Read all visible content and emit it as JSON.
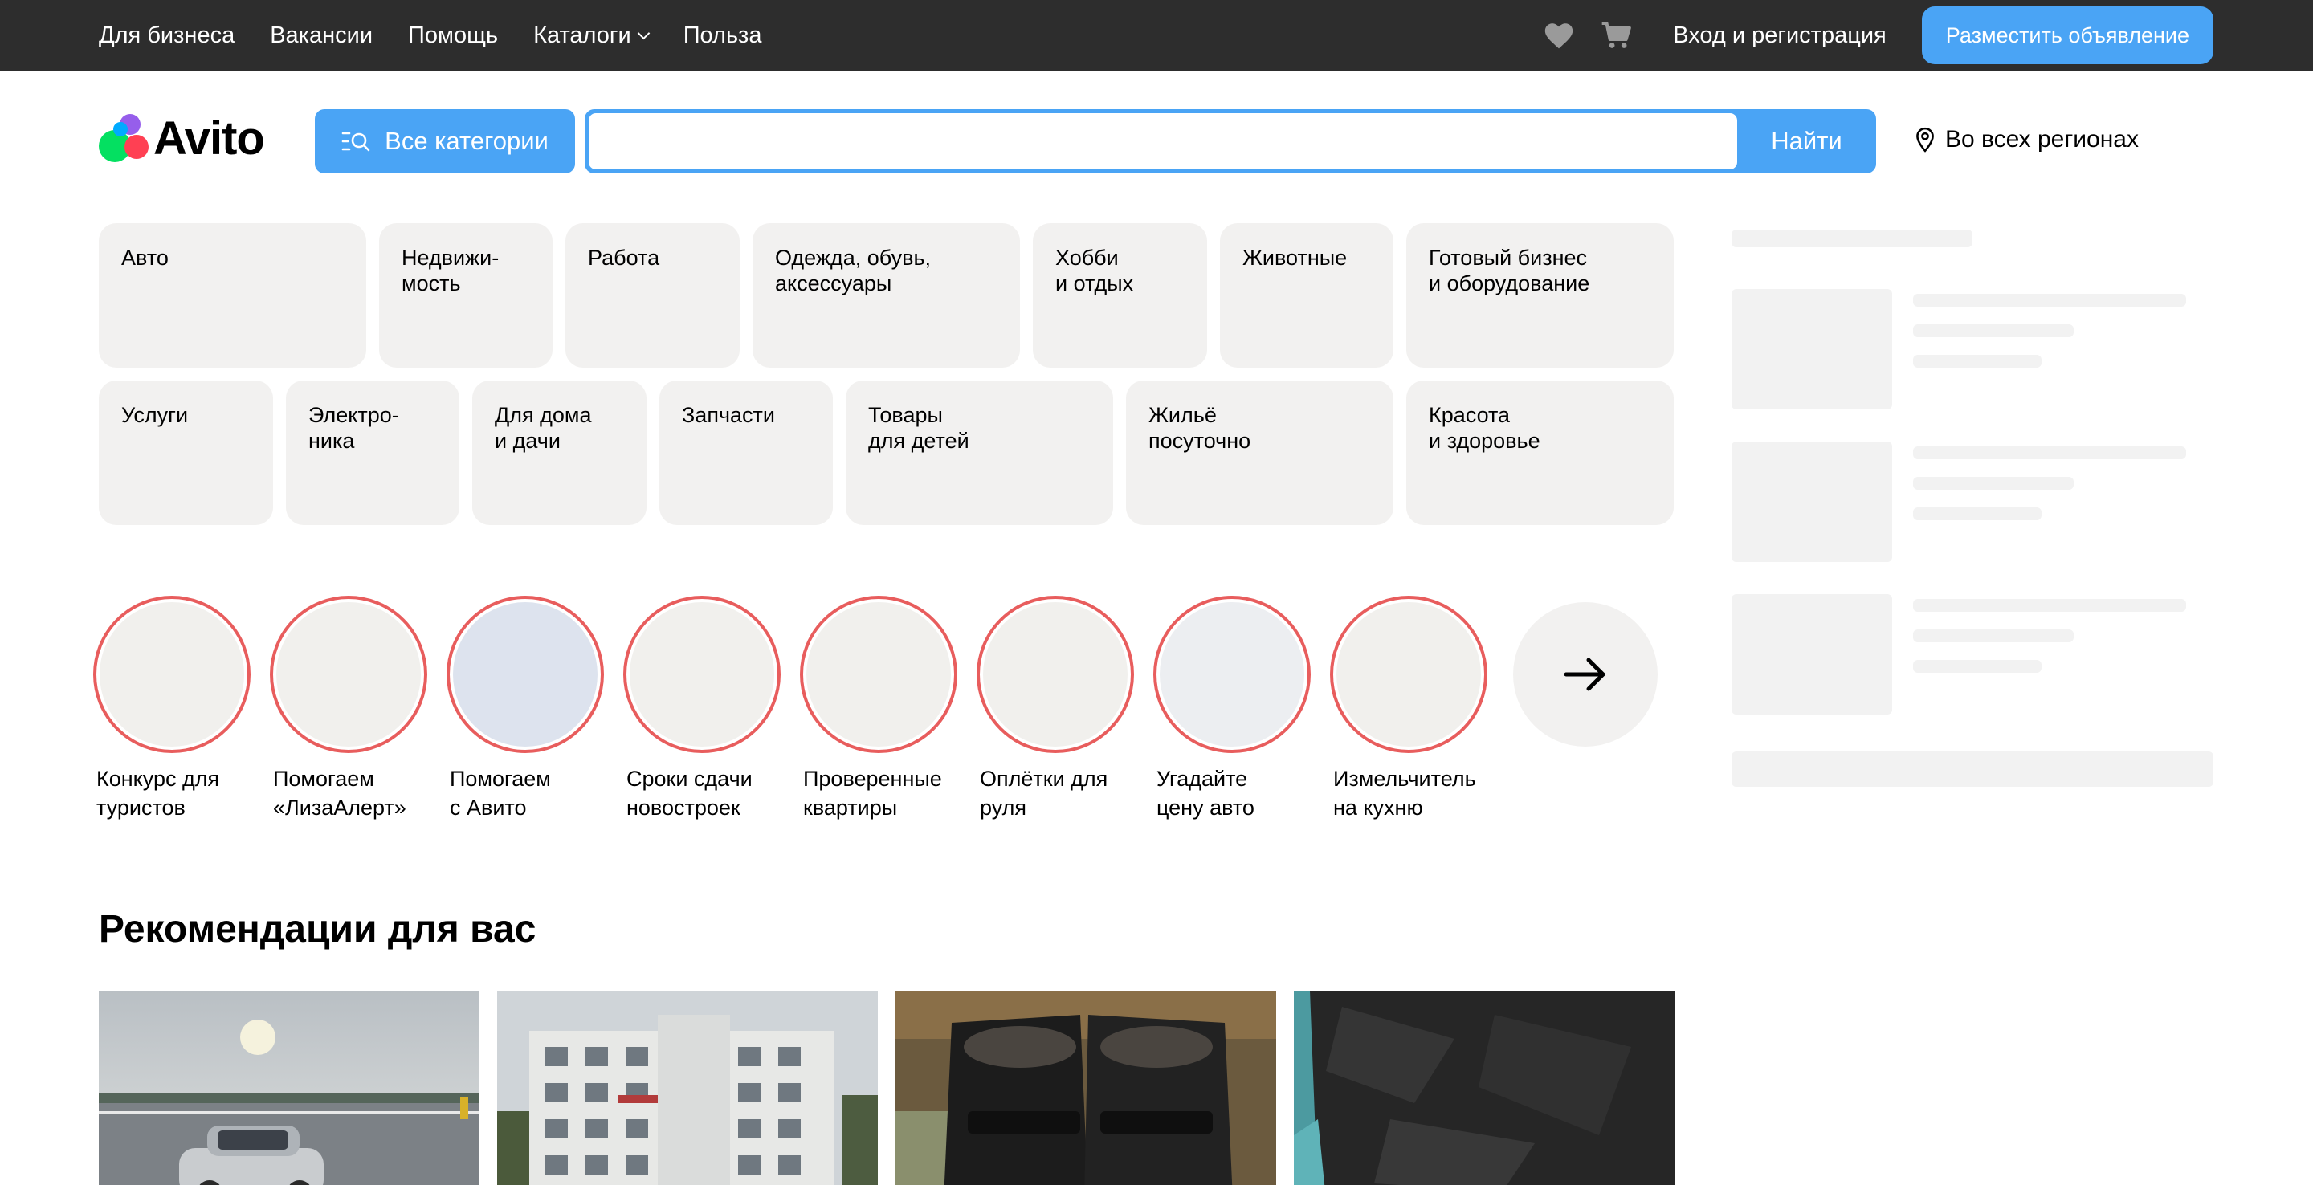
{
  "topbar": {
    "nav": [
      {
        "label": "Для бизнеса"
      },
      {
        "label": "Вакансии"
      },
      {
        "label": "Помощь"
      },
      {
        "label": "Каталоги"
      },
      {
        "label": "Польза"
      }
    ],
    "login_label": "Вход и регистрация",
    "post_ad_label": "Разместить объявление"
  },
  "header": {
    "logo_text": "Avito",
    "categories_button": "Все категории",
    "search": {
      "value": "",
      "placeholder": ""
    },
    "search_button": "Найти",
    "region": "Во всех регионах"
  },
  "categories": {
    "row1": [
      "Авто",
      "Недвижи-\nмость",
      "Работа",
      "Одежда, обувь,\nаксессуары",
      "Хобби\nи отдых",
      "Животные",
      "Готовый бизнес\nи оборудование"
    ],
    "row2": [
      "Услуги",
      "Электро-\nника",
      "Для дома\nи дачи",
      "Запчасти",
      "Товары\nдля детей",
      "Жильё\nпосуточно",
      "Красота\nи здоровье"
    ]
  },
  "stories": [
    {
      "label": "Конкурс для\nтуристов",
      "color": "#f1f0ed"
    },
    {
      "label": "Помогаем\n«ЛизаАлерт»",
      "color": "#f1f0ed"
    },
    {
      "label": "Помогаем\nс Авито",
      "color": "#dde3ee"
    },
    {
      "label": "Сроки сдачи\nновостроек",
      "color": "#f1f0ed"
    },
    {
      "label": "Проверенные\nквартиры",
      "color": "#f1f0ed"
    },
    {
      "label": "Оплётки для\nруля",
      "color": "#f1f0ed"
    },
    {
      "label": "Угадайте\nцену авто",
      "color": "#eceef1"
    },
    {
      "label": "Измельчитель\nна кухню",
      "color": "#f1f0ed"
    }
  ],
  "recommendations": {
    "title": "Рекомендации для вас",
    "cards": [
      {
        "subject": "car"
      },
      {
        "subject": "apartment-building"
      },
      {
        "subject": "shoes"
      },
      {
        "subject": "black-bag"
      }
    ]
  },
  "colors": {
    "topbar": "#2d2d2d",
    "accent": "#4aa4f5",
    "tile": "#f2f1f0",
    "story_ring": "#e85d5d"
  }
}
